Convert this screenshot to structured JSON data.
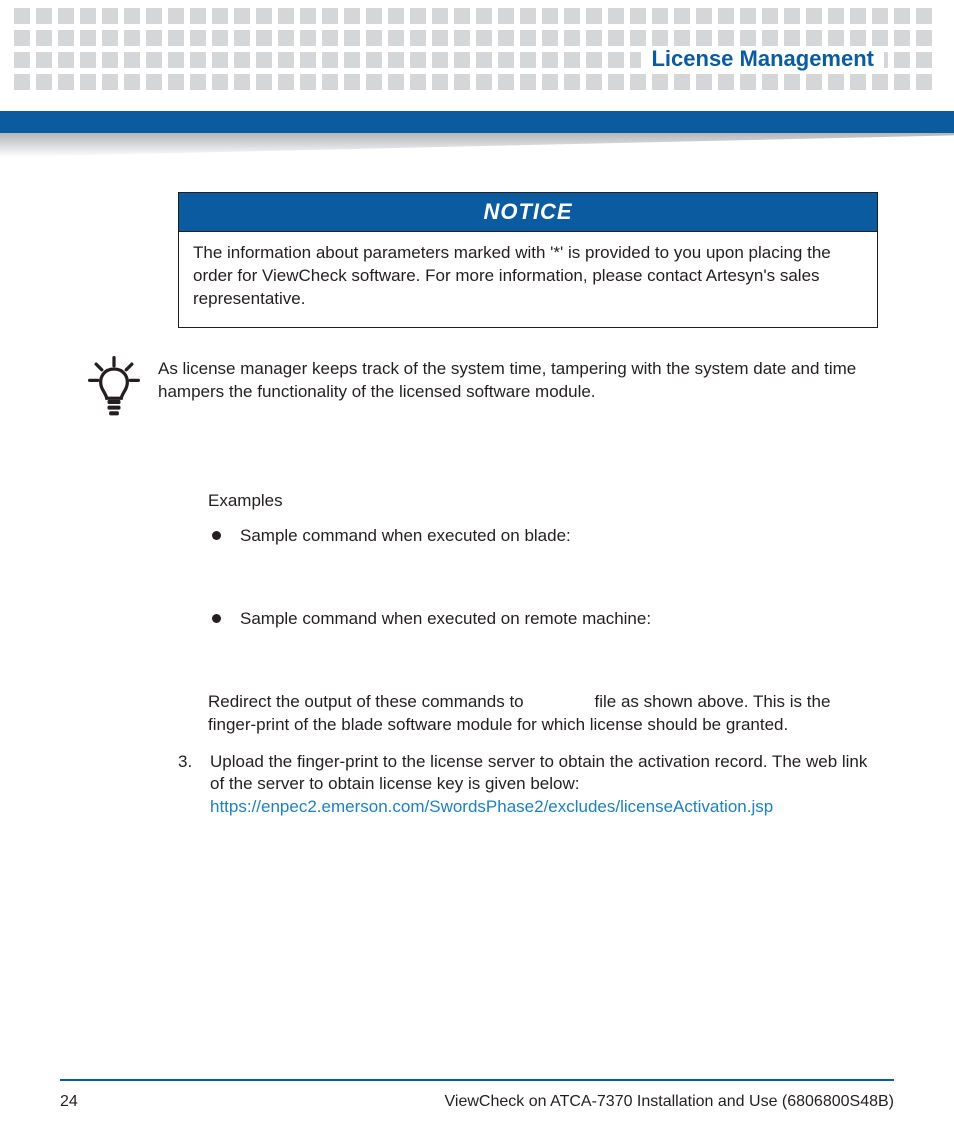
{
  "header": {
    "title": "License Management"
  },
  "notice": {
    "heading": "NOTICE",
    "body": "The information about parameters marked with '*' is provided to you upon placing the order for ViewCheck software. For more information, please contact Artesyn's sales representative."
  },
  "tip": {
    "text": "As license manager keeps track of the system time, tampering with the system date and time hampers the functionality of the licensed software module."
  },
  "examples": {
    "label": "Examples",
    "items": [
      "Sample command when executed on blade:",
      "Sample command when executed on remote machine:"
    ],
    "redirect_prefix": "Redirect the output of these commands to ",
    "redirect_suffix": " file as shown above. This is the finger-print of the blade software module for which license should be granted."
  },
  "step3": {
    "number": "3.",
    "text": "Upload the finger-print to the license server to obtain the activation record. The web link of the server to obtain license key is given below:",
    "link": "https://enpec2.emerson.com/SwordsPhase2/excludes/licenseActivation.jsp"
  },
  "footer": {
    "page": "24",
    "doc": "ViewCheck on ATCA-7370 Installation and Use (6806800S48B)"
  }
}
